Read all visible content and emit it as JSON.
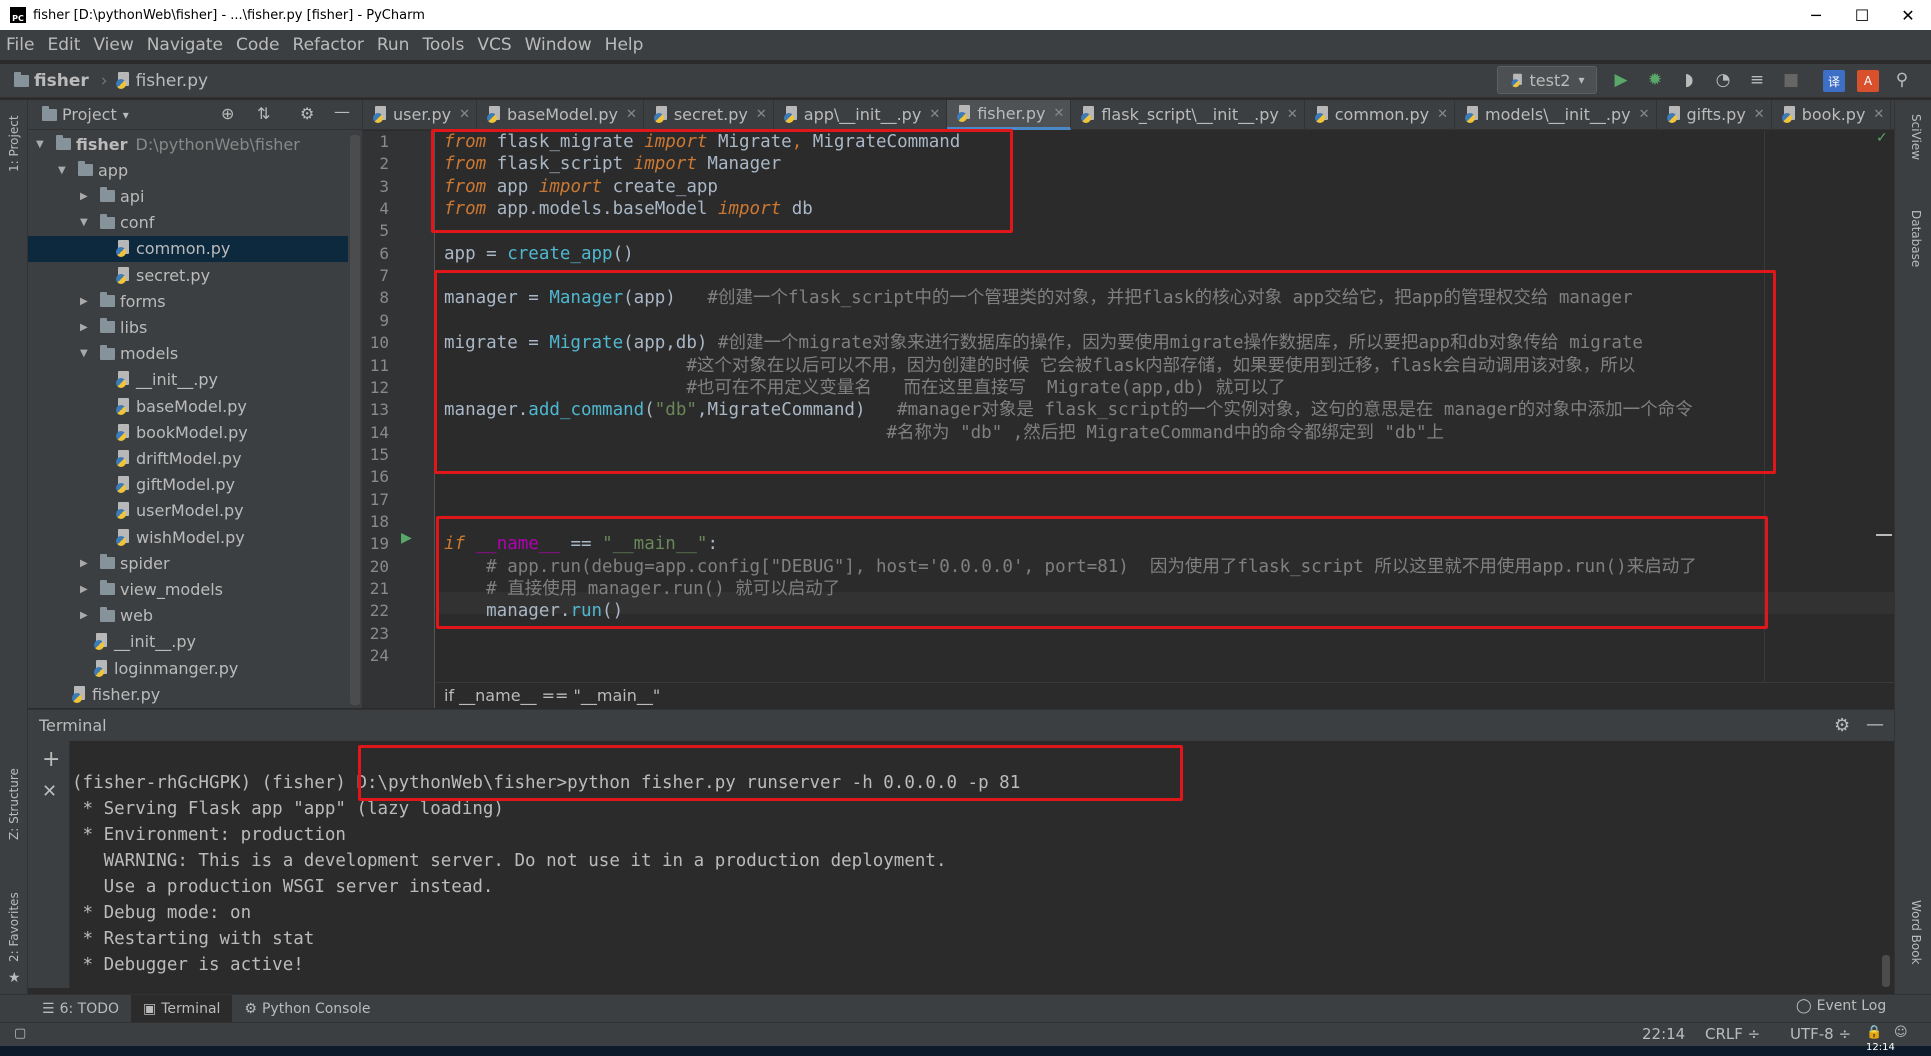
{
  "window": {
    "title": "fisher [D:\\pythonWeb\\fisher] - ...\\fisher.py [fisher] - PyCharm",
    "logo": "PC",
    "minimize": "─",
    "maximize": "☐",
    "close": "✕"
  },
  "menu": [
    "File",
    "Edit",
    "View",
    "Navigate",
    "Code",
    "Refactor",
    "Run",
    "Tools",
    "VCS",
    "Window",
    "Help"
  ],
  "breadcrumb": {
    "project": "fisher",
    "file": "fisher.py",
    "separator": "›"
  },
  "run_config": {
    "name": "test2",
    "arrow": "▾"
  },
  "project_panel": {
    "title": "Project",
    "title_arrow": "▾",
    "tree": [
      {
        "label": "fisher",
        "suffix": "D:\\pythonWeb\\fisher",
        "type": "folder",
        "arrow": "▼",
        "bold": true
      },
      {
        "label": "app",
        "type": "folder",
        "arrow": "▼"
      },
      {
        "label": "api",
        "type": "folder",
        "arrow": "▶"
      },
      {
        "label": "conf",
        "type": "folder",
        "arrow": "▼"
      },
      {
        "label": "common.py",
        "type": "file",
        "selected": true
      },
      {
        "label": "secret.py",
        "type": "file"
      },
      {
        "label": "forms",
        "type": "folder",
        "arrow": "▶"
      },
      {
        "label": "libs",
        "type": "folder",
        "arrow": "▶"
      },
      {
        "label": "models",
        "type": "folder",
        "arrow": "▼"
      },
      {
        "label": "__init__.py",
        "type": "file"
      },
      {
        "label": "baseModel.py",
        "type": "file"
      },
      {
        "label": "bookModel.py",
        "type": "file"
      },
      {
        "label": "driftModel.py",
        "type": "file"
      },
      {
        "label": "giftModel.py",
        "type": "file"
      },
      {
        "label": "userModel.py",
        "type": "file"
      },
      {
        "label": "wishModel.py",
        "type": "file"
      },
      {
        "label": "spider",
        "type": "folder",
        "arrow": "▶"
      },
      {
        "label": "view_models",
        "type": "folder",
        "arrow": "▶"
      },
      {
        "label": "web",
        "type": "folder",
        "arrow": "▶"
      },
      {
        "label": "__init__.py",
        "type": "file"
      },
      {
        "label": "loginmanger.py",
        "type": "file"
      },
      {
        "label": "fisher.py",
        "type": "file"
      }
    ]
  },
  "tabs": [
    {
      "label": "user.py"
    },
    {
      "label": "baseModel.py"
    },
    {
      "label": "secret.py"
    },
    {
      "label": "app\\__init__.py"
    },
    {
      "label": "fisher.py",
      "active": true
    },
    {
      "label": "flask_script\\__init__.py"
    },
    {
      "label": "common.py"
    },
    {
      "label": "models\\__init__.py"
    },
    {
      "label": "gifts.py"
    },
    {
      "label": "book.py"
    }
  ],
  "tab_close": "✕",
  "editor": {
    "line_numbers": [
      "1",
      "2",
      "3",
      "4",
      "5",
      "6",
      "7",
      "8",
      "9",
      "10",
      "11",
      "12",
      "13",
      "14",
      "15",
      "16",
      "17",
      "18",
      "19",
      "20",
      "21",
      "22",
      "23",
      "24"
    ],
    "lines": [
      "<span class='kw'>from</span> flask_migrate <span class='kw'>import</span> Migrate<span class='kwb'>,</span> MigrateCommand",
      "<span class='kw'>from</span> flask_script <span class='kw'>import</span> Manager",
      "<span class='kw'>from</span> app <span class='kw'>import</span> create_app",
      "<span class='kw'>from</span> app.models.baseModel <span class='kw'>import</span> db",
      "",
      "app = <span class='fn'>create_app</span>()",
      "",
      "manager = <span class='fn'>Manager</span>(app)   <span class='cm'>#创建一个flask_script中的一个管理类的对象，并把flask的核心对象 app交给它，把app的管理权交给 manager</span>",
      "",
      "migrate = <span class='fn'>Migrate</span>(app,db) <span class='cm'>#创建一个migrate对象来进行数据库的操作，因为要使用migrate操作数据库，所以要把app和db对象传给 migrate</span>",
      "                       <span class='cm'>#这个对象在以后可以不用，因为创建的时候 它会被flask内部存储，如果要使用到迁移，flask会自动调用该对象，所以</span>",
      "                       <span class='cm'>#也可在不用定义变量名   而在这里直接写  Migrate(app,db) 就可以了</span>",
      "manager.<span class='fn'>add_command</span>(<span class='str'>\"db\"</span>,MigrateCommand)   <span class='cm'>#manager对象是 flask_script的一个实例对象，这句的意思是在 manager的对象中添加一个命令</span>",
      "                                          <span class='cm'>#名称为 \"db\" ,然后把 MigrateCommand中的命令都绑定到 \"db\"上</span>",
      "",
      "",
      "",
      "",
      "<span class='kw'>if</span> <span class='sp'>__name__</span> == <span class='str'>\"__main__\"</span>:",
      "    <span class='cm'># app.run(debug=app.config[\"DEBUG\"], host='0.0.0.0', port=81)  因为使用了flask_script 所以这里就不用使用app.run()来启动了</span>",
      "    <span class='cm'># 直接使用 manager.run() 就可以启动了</span>",
      "    manager.<span class='fn'>run</span>()",
      "",
      ""
    ],
    "breadcrumb_footer": "if __name__ == \"__main__\""
  },
  "terminal": {
    "title": "Terminal",
    "add": "+",
    "close": "✕",
    "gear": "⚙",
    "hide": "—",
    "lines": [
      "(fisher-rhGcHGPK) (fisher) D:\\pythonWeb\\fisher>python fisher.py runserver -h 0.0.0.0 -p 81",
      " * Serving Flask app \"app\" (lazy loading)",
      " * Environment: production",
      "   WARNING: This is a development server. Do not use it in a production deployment.",
      "   Use a production WSGI server instead.",
      " * Debug mode: on",
      " * Restarting with stat",
      " * Debugger is active!"
    ]
  },
  "bottom_tabs": [
    {
      "label": "6: TODO",
      "icon": "☰"
    },
    {
      "label": "Terminal",
      "icon": "▣",
      "active": true
    },
    {
      "label": "Python Console",
      "icon": "⚙"
    }
  ],
  "event_log": "Event Log",
  "status": {
    "position": "22:14",
    "line_sep": "CRLF ÷",
    "encoding": "UTF-8 ÷",
    "clock": "12:14"
  },
  "side_labels": {
    "project": "1: Project",
    "structure": "Z: Structure",
    "favorites": "2: Favorites",
    "sciview": "SciView",
    "database": "Database",
    "wordbook": "Word Book"
  },
  "colors": {
    "accent": "#4a88c7",
    "highlight_box": "#e0161b",
    "run_green": "#59a869"
  }
}
